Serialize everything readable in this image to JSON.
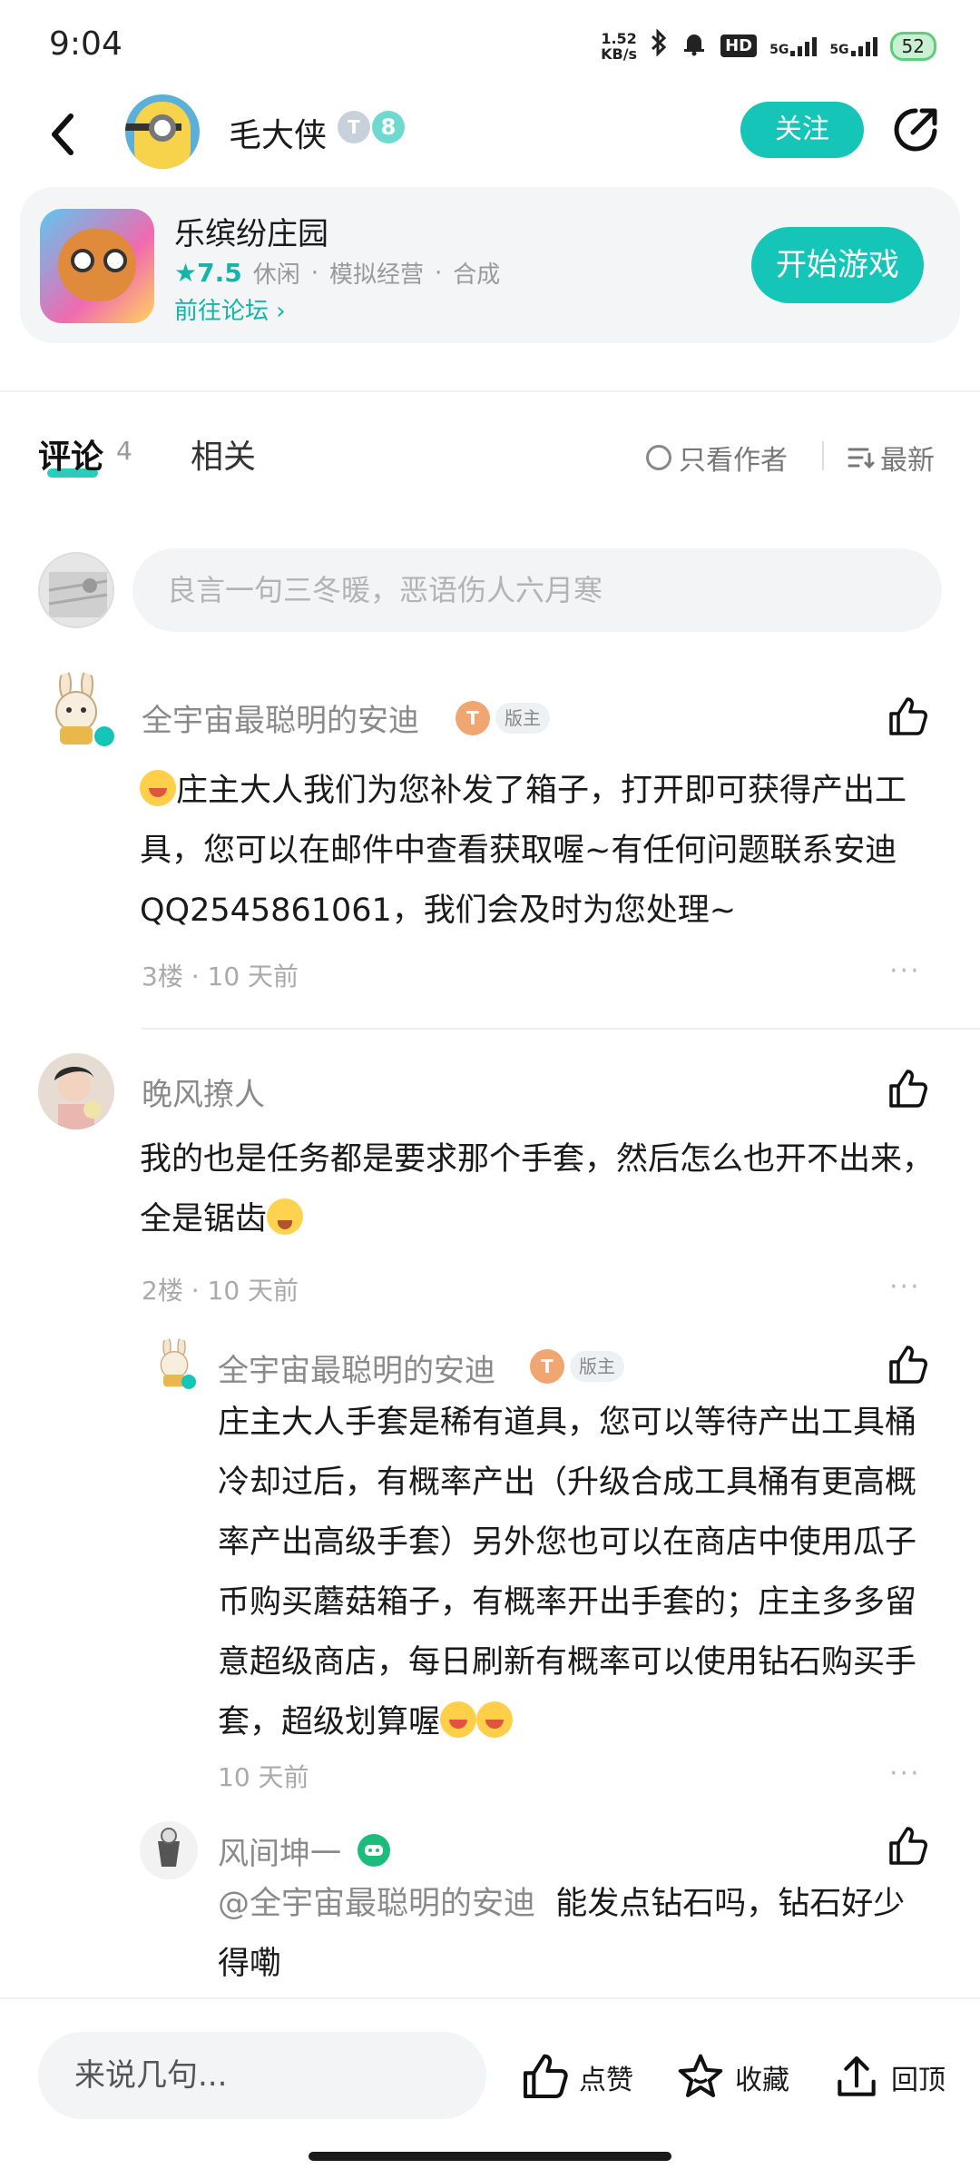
{
  "status_bar": {
    "time": "9:04",
    "net_speed_value": "1.52",
    "net_speed_unit": "KB/s",
    "hd_label": "HD",
    "signal1": "5G",
    "signal2": "5G",
    "battery": "52"
  },
  "header": {
    "username": "毛大侠",
    "level_badge_1": "T",
    "level_badge_2": "8",
    "follow_label": "关注"
  },
  "game": {
    "name": "乐缤纷庄园",
    "score": "★7.5",
    "tags": [
      "休闲",
      "模拟经营",
      "合成"
    ],
    "separator": "·",
    "forum_link": "前往论坛 ›",
    "play_label": "开始游戏"
  },
  "tabs": {
    "comment_label": "评论",
    "comment_count": "4",
    "related_label": "相关",
    "only_author_label": "只看作者",
    "sort_label": "最新"
  },
  "comment_input": {
    "placeholder": "良言一句三冬暖，恶语伤人六月寒"
  },
  "comments": [
    {
      "author": "全宇宙最聪明的安迪",
      "badge_t": "T",
      "badge_role": "版主",
      "text": "庄主大人我们为您补发了箱子，打开即可获得产出工具，您可以在邮件中查看获取喔~有任何问题联系安迪QQ2545861061，我们会及时为您处理~",
      "floor_time": "3楼 · 10 天前",
      "more": "···"
    },
    {
      "author": "晚风撩人",
      "text": "我的也是任务都是要求那个手套，然后怎么也开不出来，全是锯齿",
      "floor_time": "2楼 · 10 天前",
      "more": "···",
      "replies": [
        {
          "author": "全宇宙最聪明的安迪",
          "badge_t": "T",
          "badge_role": "版主",
          "text": "庄主大人手套是稀有道具，您可以等待产出工具桶冷却过后，有概率产出（升级合成工具桶有更高概率产出高级手套）另外您也可以在商店中使用瓜子币购买蘑菇箱子，有概率开出手套的；庄主多多留意超级商店，每日刷新有概率可以使用钻石购买手套，超级划算喔",
          "time": "10 天前",
          "more": "···"
        },
        {
          "author": "风间坤一",
          "mention": "@全宇宙最聪明的安迪",
          "text": "能发点钻石吗，钻石好少得嘞"
        }
      ]
    }
  ],
  "bottom_bar": {
    "input_placeholder": "来说几句...",
    "like_label": "点赞",
    "favorite_label": "收藏",
    "top_label": "回顶"
  },
  "colors": {
    "accent": "#15c5b7",
    "muted_text": "#8a8a8a"
  }
}
